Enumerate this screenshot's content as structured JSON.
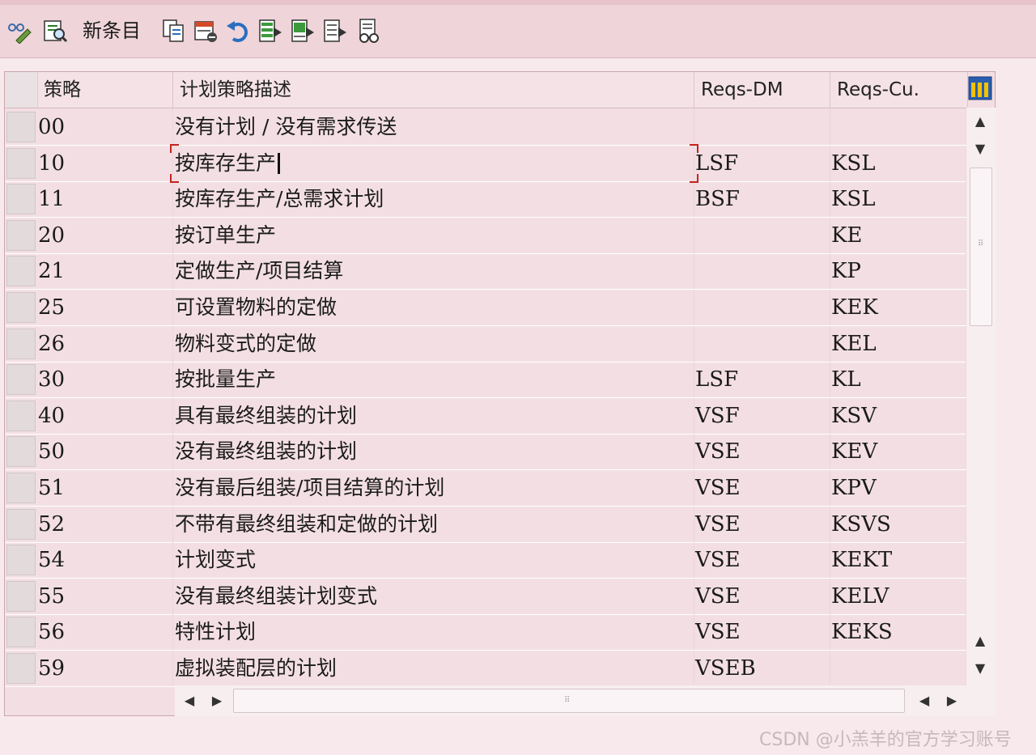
{
  "toolbar": {
    "new_entries_label": "新条目",
    "icons": [
      "display-change-icon",
      "details-icon",
      "copy-icon",
      "delete-icon",
      "undo-icon",
      "select-all-icon",
      "select-block-icon",
      "deselect-all-icon",
      "print-icon"
    ]
  },
  "table": {
    "headers": {
      "strategy": "策略",
      "description": "计划策略描述",
      "reqs_dm": "Reqs-DM",
      "reqs_cu": "Reqs-Cu."
    },
    "rows": [
      {
        "code": "00",
        "desc": "没有计划 / 没有需求传送",
        "dm": "",
        "cu": ""
      },
      {
        "code": "10",
        "desc": "按库存生产",
        "dm": "LSF",
        "cu": "KSL"
      },
      {
        "code": "11",
        "desc": "按库存生产/总需求计划",
        "dm": "BSF",
        "cu": "KSL"
      },
      {
        "code": "20",
        "desc": "按订单生产",
        "dm": "",
        "cu": "KE"
      },
      {
        "code": "21",
        "desc": "定做生产/项目结算",
        "dm": "",
        "cu": "KP"
      },
      {
        "code": "25",
        "desc": "可设置物料的定做",
        "dm": "",
        "cu": "KEK"
      },
      {
        "code": "26",
        "desc": "物料变式的定做",
        "dm": "",
        "cu": "KEL"
      },
      {
        "code": "30",
        "desc": "按批量生产",
        "dm": "LSF",
        "cu": "KL"
      },
      {
        "code": "40",
        "desc": "具有最终组装的计划",
        "dm": "VSF",
        "cu": "KSV"
      },
      {
        "code": "50",
        "desc": "没有最终组装的计划",
        "dm": "VSE",
        "cu": "KEV"
      },
      {
        "code": "51",
        "desc": "没有最后组装/项目结算的计划",
        "dm": "VSE",
        "cu": "KPV"
      },
      {
        "code": "52",
        "desc": "不带有最终组装和定做的计划",
        "dm": "VSE",
        "cu": "KSVS"
      },
      {
        "code": "54",
        "desc": "计划变式",
        "dm": "VSE",
        "cu": "KEKT"
      },
      {
        "code": "55",
        "desc": "没有最终组装计划变式",
        "dm": "VSE",
        "cu": "KELV"
      },
      {
        "code": "56",
        "desc": "特性计划",
        "dm": "VSE",
        "cu": "KEKS"
      },
      {
        "code": "59",
        "desc": "虚拟装配层的计划",
        "dm": "VSEB",
        "cu": ""
      }
    ]
  },
  "watermark": "CSDN @小羔羊的官方学习账号",
  "colors": {
    "toolbar_bg": "#efd4da",
    "table_bg": "#f3dfe3",
    "focus_red": "#c4231f"
  }
}
